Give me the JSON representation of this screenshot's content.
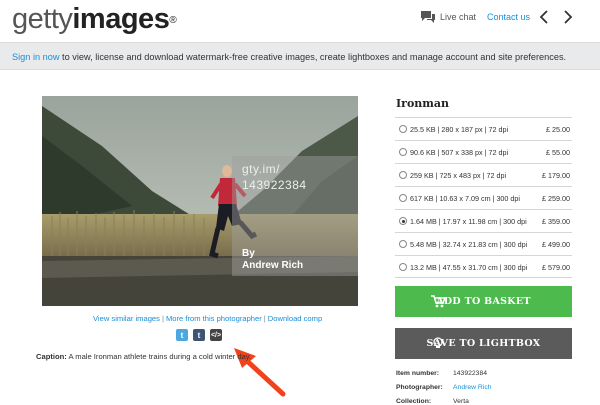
{
  "header": {
    "logo_light": "getty",
    "logo_bold": "images",
    "logo_mark": "®",
    "live_chat": "Live chat",
    "contact_us": "Contact us"
  },
  "signin_bar": {
    "link": "Sign in now",
    "text": " to view, license and download watermark-free creative images, create lightboxes and manage account and site preferences."
  },
  "image": {
    "overlay_line1": "gty.im/",
    "overlay_line2": "143922384",
    "overlay_by": "By",
    "overlay_name": "Andrew Rich"
  },
  "image_links": {
    "similar": "View similar images",
    "photographer": "More from this photographer",
    "comp": "Download comp",
    "separator": "|"
  },
  "social": {
    "twitter_glyph": "t",
    "tumblr_glyph": "t",
    "embed_glyph": "</>"
  },
  "caption": {
    "label": "Caption:",
    "text": " A male Ironman athlete trains during a cold winter day."
  },
  "product": {
    "title": "Ironman",
    "sizes": [
      {
        "desc": "25.5 KB  |  280 x 187 px  |  72 dpi",
        "price": "£ 25.00",
        "selected": false
      },
      {
        "desc": "90.6 KB  |  507 x 338 px  |  72 dpi",
        "price": "£ 55.00",
        "selected": false
      },
      {
        "desc": "259 KB  |  725 x 483 px  |  72 dpi",
        "price": "£ 179.00",
        "selected": false
      },
      {
        "desc": "617 KB  |  10.63 x 7.09 cm  |  300 dpi",
        "price": "£ 259.00",
        "selected": false
      },
      {
        "desc": "1.64 MB  |  17.97 x 11.98 cm  |  300 dpi",
        "price": "£ 359.00",
        "selected": true
      },
      {
        "desc": "5.48 MB  |  32.74 x 21.83 cm  |  300 dpi",
        "price": "£ 499.00",
        "selected": false
      },
      {
        "desc": "13.2 MB  |  47.55 x 31.70 cm  |  300 dpi",
        "price": "£ 579.00",
        "selected": false
      }
    ],
    "add_to_basket": "ADD TO BASKET",
    "save_to_lightbox": "SAVE TO LIGHTBOX"
  },
  "details": {
    "item_number_label": "Item number:",
    "item_number": "143922384",
    "photographer_label": "Photographer:",
    "photographer": "Andrew Rich",
    "collection_label": "Collection:",
    "collection": "Verta"
  },
  "colors": {
    "accent_link": "#1a8fd8",
    "basket_green": "#4cba4c",
    "lightbox_gray": "#5b5b5b",
    "annotation_arrow": "#f2421b"
  },
  "icons": [
    "chat-icon",
    "chevron-left-icon",
    "chevron-right-icon",
    "cart-icon",
    "lightbulb-icon",
    "twitter-icon",
    "tumblr-icon",
    "embed-icon"
  ]
}
